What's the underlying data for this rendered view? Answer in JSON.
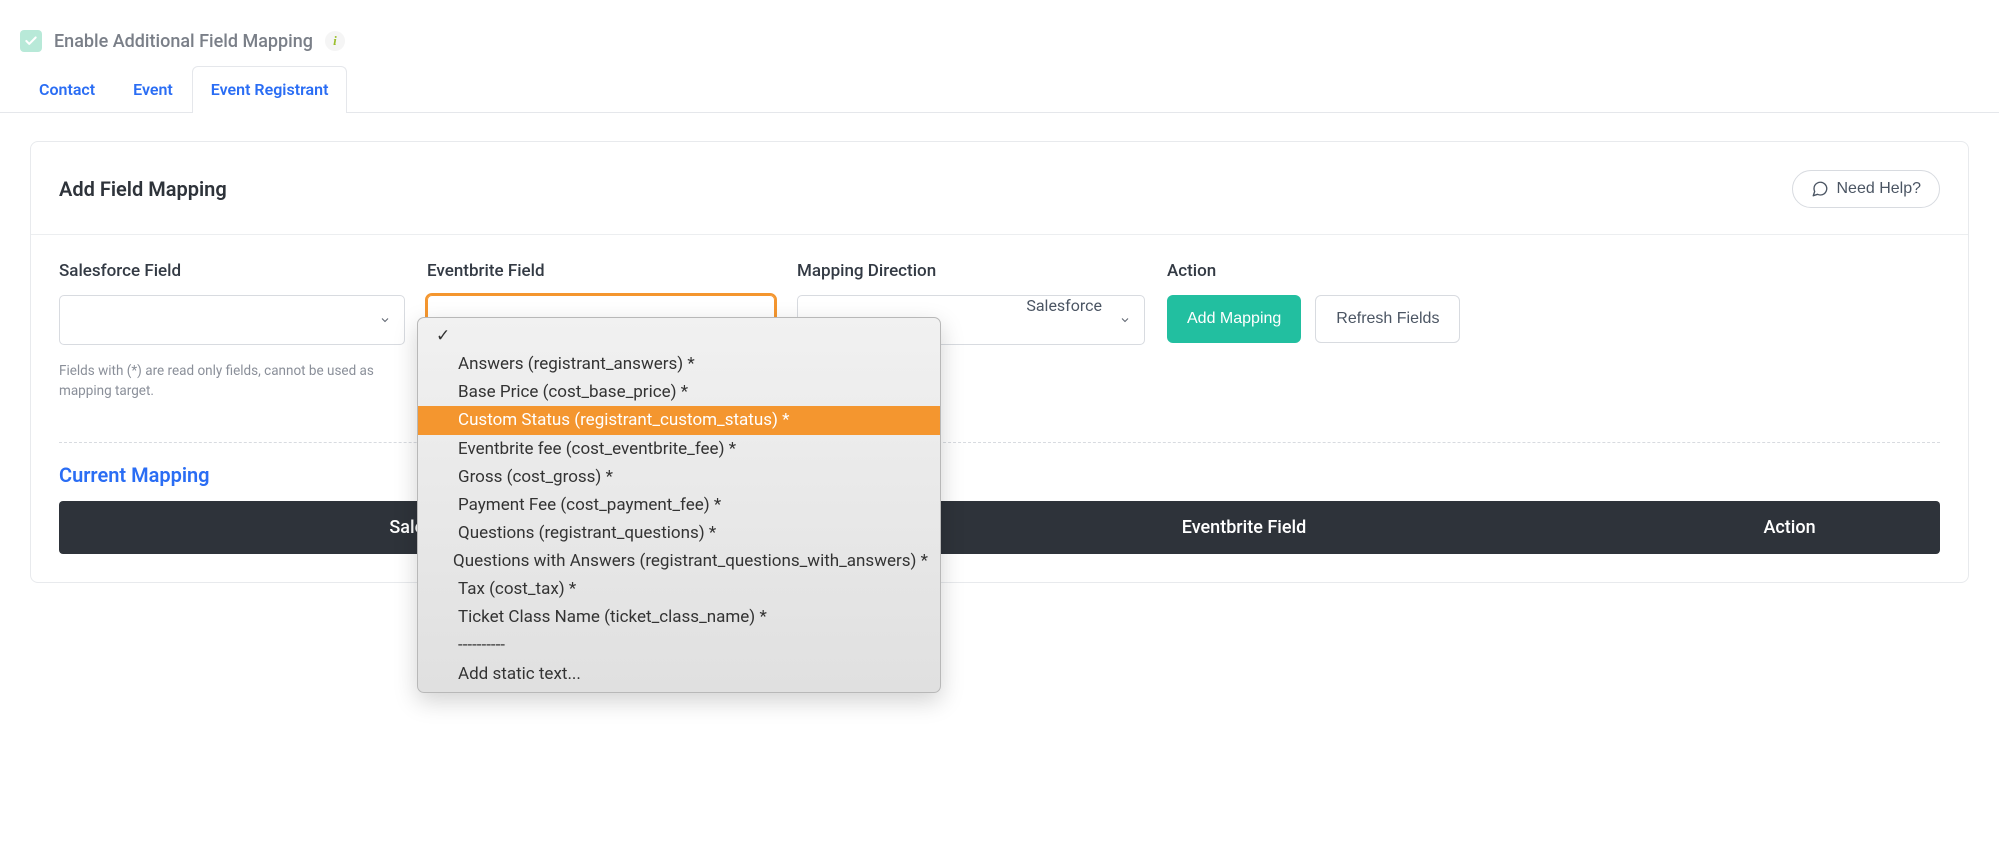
{
  "header": {
    "enable_label": "Enable Additional Field Mapping"
  },
  "tabs": [
    {
      "label": "Contact"
    },
    {
      "label": "Event"
    },
    {
      "label": "Event Registrant"
    }
  ],
  "card": {
    "title": "Add Field Mapping",
    "help_label": "Need Help?"
  },
  "columns": {
    "sf_label": "Salesforce Field",
    "eb_label": "Eventbrite Field",
    "dir_label": "Mapping Direction",
    "action_label": "Action",
    "sf_helper": "Fields with (*) are read only fields, cannot be used as mapping target.",
    "dir_value": "Salesforce"
  },
  "buttons": {
    "add": "Add Mapping",
    "refresh": "Refresh Fields"
  },
  "dropdown": {
    "options": [
      "Answers (registrant_answers) *",
      "Base Price (cost_base_price) *",
      "Custom Status (registrant_custom_status) *",
      "Eventbrite fee (cost_eventbrite_fee) *",
      "Gross (cost_gross) *",
      "Payment Fee (cost_payment_fee) *",
      "Questions (registrant_questions) *",
      "Questions with Answers (registrant_questions_with_answers) *",
      "Tax (cost_tax) *",
      "Ticket Class Name (ticket_class_name) *",
      "----------",
      "Add static text..."
    ],
    "highlighted": 2
  },
  "current": {
    "title": "Current Mapping",
    "headers": [
      "Salesforce Field",
      "Eventbrite Field",
      "Action"
    ]
  }
}
